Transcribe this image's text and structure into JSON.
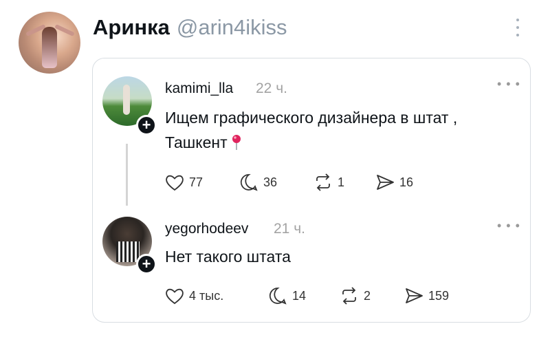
{
  "tweet": {
    "display_name": "Аринка",
    "handle": "@arin4ikiss"
  },
  "posts": [
    {
      "username": "kamimi_lla",
      "time": "22 ч.",
      "text": "Ищем графического дизайнера в штат , Ташкент",
      "likes": "77",
      "replies": "36",
      "reposts": "1",
      "shares": "16"
    },
    {
      "username": "yegorhodeev",
      "time": "21 ч.",
      "text": "Нет такого штата",
      "likes": "4 тыс.",
      "replies": "14",
      "reposts": "2",
      "shares": "159"
    }
  ],
  "colors": {
    "text": "#0f1419",
    "muted": "#a3a3a3",
    "border": "#d8dde2",
    "pin": "#e0245e"
  }
}
